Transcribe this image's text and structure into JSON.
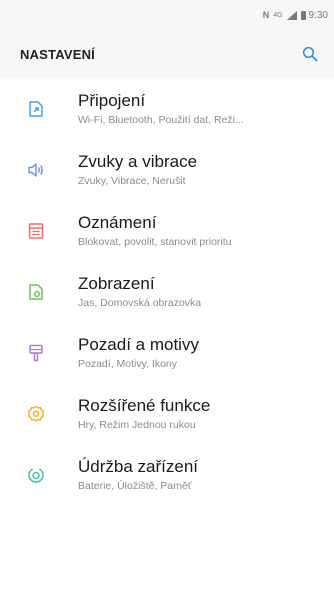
{
  "status_bar": {
    "nfc": "N",
    "network": "4G",
    "time": "9:30"
  },
  "header": {
    "title": "NASTAVENÍ",
    "search_icon": "search-icon"
  },
  "colors": {
    "connections": "#4a9fe8",
    "sounds": "#6b8de0",
    "notifications": "#ee6f6f",
    "display": "#6fbf5c",
    "wallpaper": "#b07ad6",
    "advanced": "#f2b31b",
    "maintenance": "#3fc0a7",
    "search": "#3d8de8"
  },
  "items": [
    {
      "title": "Připojení",
      "subtitle": "Wi-Fi, Bluetooth, Použití dat, Reži...",
      "icon": "connections-icon"
    },
    {
      "title": "Zvuky a vibrace",
      "subtitle": "Zvuky, Vibrace, Nerušit",
      "icon": "speaker-icon"
    },
    {
      "title": "Oznámení",
      "subtitle": "Blokovat, povolit, stanovit prioritu",
      "icon": "notifications-icon"
    },
    {
      "title": "Zobrazení",
      "subtitle": "Jas, Domovská obrazovka",
      "icon": "display-icon"
    },
    {
      "title": "Pozadí a motivy",
      "subtitle": "Pozadí, Motivy, Ikony",
      "icon": "brush-icon"
    },
    {
      "title": "Rozšířené funkce",
      "subtitle": "Hry, Režim Jednou rukou",
      "icon": "gear-icon"
    },
    {
      "title": "Údržba zařízení",
      "subtitle": "Baterie, Úložiště, Paměť",
      "icon": "maintenance-icon"
    }
  ]
}
